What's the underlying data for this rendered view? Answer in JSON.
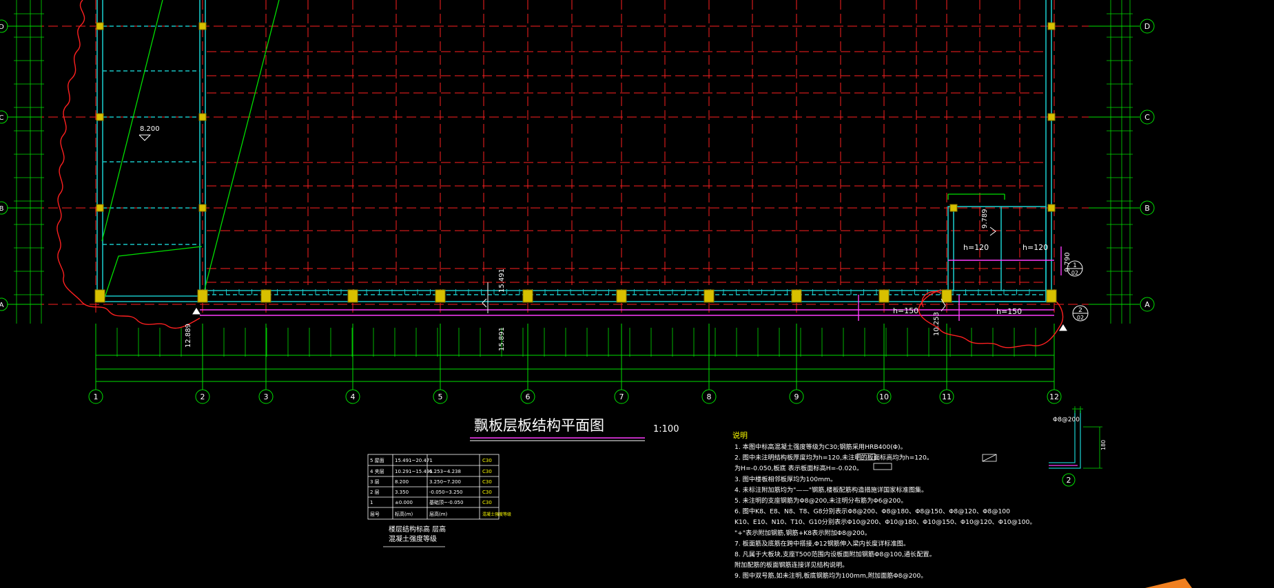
{
  "drawing": {
    "title": "飘板层板结构平面图",
    "scale": "1:100",
    "colors": {
      "background": "#000000",
      "axis_grid": "#ff2020",
      "dimension": "#00e000",
      "wall": "#19c6c6",
      "column_fill": "#d8c000",
      "cloud": "#ff2020",
      "annotation": "#ff3cff",
      "text": "#ffffff",
      "notes_title": "#ffff00"
    },
    "axes_bottom": [
      "1",
      "2",
      "3",
      "4",
      "5",
      "6",
      "7",
      "8",
      "9",
      "10",
      "11",
      "12"
    ],
    "axes_right": [
      "A",
      "B",
      "C",
      "D"
    ],
    "axes_left": [
      "A",
      "B",
      "C",
      "D"
    ],
    "slab_labels": {
      "h120_left": "h=120",
      "h120_right": "h=120",
      "h150_mid": "h=150",
      "h150_right": "h=150",
      "level_9789": "9.789",
      "level_8200": "8.200",
      "level_9790": "9.790",
      "level_12889": "12.889",
      "level_15491": "15.491",
      "level_15891": "15.891",
      "level_10253": "10.253"
    },
    "section_marks": [
      {
        "num": "1",
        "sheet": "02"
      },
      {
        "num": "2",
        "sheet": "02"
      }
    ],
    "detail": {
      "number": "2",
      "rebar_label": "Φ8@200",
      "dim_label": "180"
    },
    "notes": {
      "title": "说明",
      "lines": [
        "1. 本图中标高混凝土强度等级为C30;钢筋采用HRB400(Φ)。",
        "2. 图中未注明结构板厚度均为h=120,未注明的板面标高均为h=120。",
        "   为H=-0.050,板底  表示板面标高H=-0.020。",
        "3. 图中楼板相邻板厚均为100mm。",
        "4. 未标注附加筋均为\"——\"钢筋,楼板配筋构造措施详国家标准图集。",
        "5. 未注明的支座钢筋为Φ8@200,未注明分布筋为Φ6@200。",
        "6. 图中K8、E8、N8、T8、G8分别表示Φ8@200、Φ8@180、Φ8@150、Φ8@120、Φ8@100",
        "   K10、E10、N10、T10、G10分别表示Φ10@200、Φ10@180、Φ10@150、Φ10@120、Φ10@100。",
        "   \"+\"表示附加钢筋,钢筋+K8表示附加Φ8@200。",
        "7. 板面筋及底筋在跨中搭接,Φ12钢筋伸入梁内长度详标准图。",
        "8. 凡属于大板块,支座T500范围内设板面附加钢筋Φ8@100,通长配置。",
        "   附加配筋的板面钢筋连接详见结构说明。",
        "9. 图中双号筋,如未注明,板底钢筋均为100mm,附加面筋Φ8@200。"
      ]
    },
    "floor_table": {
      "rows": [
        [
          "5 屋面",
          "15.491~20.471",
          "",
          "C30"
        ],
        [
          "4 夹层",
          "10.291~15.491",
          "6.253~4.238",
          "C30"
        ],
        [
          "3 层",
          "8.200",
          "3.250~7.200",
          "C30"
        ],
        [
          "2 层",
          "3.350",
          "-0.050~3.250",
          "C30"
        ],
        [
          "1",
          "±0.000",
          "基础顶~-0.050",
          "C30"
        ],
        [
          "层号",
          "标高(m)",
          "层高(m)",
          "混凝土强度等级"
        ]
      ],
      "caption_line1": "楼层结构标高 层高",
      "caption_line2": "混凝土强度等级"
    }
  }
}
